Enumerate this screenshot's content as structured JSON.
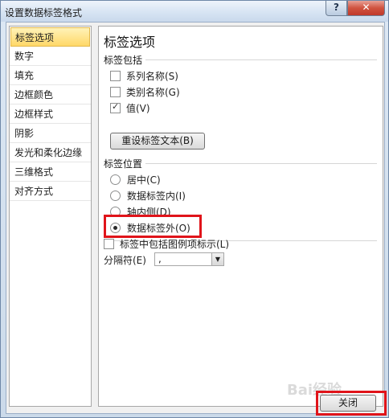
{
  "window": {
    "title": "设置数据标签格式",
    "help_label": "?",
    "close_label": "✕"
  },
  "sidebar": {
    "items": [
      {
        "label": "标签选项",
        "selected": true
      },
      {
        "label": "数字"
      },
      {
        "label": "填充"
      },
      {
        "label": "边框颜色"
      },
      {
        "label": "边框样式"
      },
      {
        "label": "阴影"
      },
      {
        "label": "发光和柔化边缘"
      },
      {
        "label": "三维格式"
      },
      {
        "label": "对齐方式"
      }
    ]
  },
  "panel": {
    "title": "标签选项",
    "label_contains": {
      "heading": "标签包括",
      "series_name": {
        "label": "系列名称(S)",
        "checked": false
      },
      "category_name": {
        "label": "类别名称(G)",
        "checked": false
      },
      "value": {
        "label": "值(V)",
        "checked": true
      },
      "reset_button": "重设标签文本(B)"
    },
    "label_position": {
      "heading": "标签位置",
      "options": [
        {
          "label": "居中(C)",
          "checked": false
        },
        {
          "label": "数据标签内(I)",
          "checked": false
        },
        {
          "label": "轴内侧(D)",
          "checked": false
        },
        {
          "label": "数据标签外(O)",
          "checked": true
        }
      ]
    },
    "include_legend_key": {
      "label": "标签中包括图例项标示(L)",
      "checked": false
    },
    "separator": {
      "label": "分隔符(E)",
      "value": ","
    }
  },
  "footer": {
    "close_button": "关闭"
  },
  "watermark": "Bai经验",
  "colors": {
    "highlight": "#e0141a",
    "selected_bg": "#ffd868"
  }
}
